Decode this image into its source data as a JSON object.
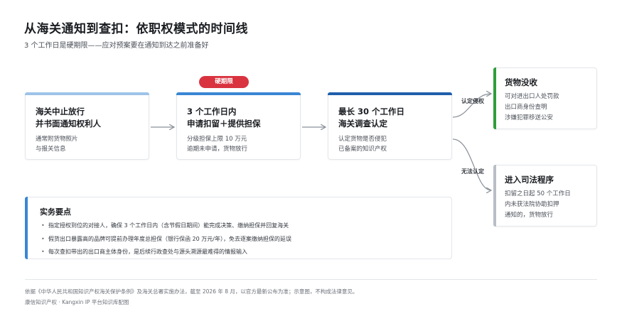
{
  "title": "从海关通知到查扣：依职权模式的时间线",
  "subtitle": "3 个工作日是硬期限——应对预案要在通知到达之前准备好",
  "badge": "硬期限",
  "steps": [
    {
      "heading": [
        "海关中止放行",
        "并书面通知权利人"
      ],
      "desc": [
        "通常附货物照片",
        "与报关信息"
      ]
    },
    {
      "heading": [
        "3 个工作日内",
        "申请扣留＋提供担保"
      ],
      "desc": [
        "分级担保上限 10 万元",
        "逾期未申请，货物放行"
      ]
    },
    {
      "heading": [
        "最长 30 个工作日",
        "海关调查认定"
      ],
      "desc": [
        "认定货物是否侵犯",
        "已备案的知识产权"
      ]
    }
  ],
  "branches": {
    "upper_label": "认定侵权",
    "lower_label": "无法认定"
  },
  "outcomes": [
    {
      "heading": "货物没收",
      "desc": [
        "可对进出口人处罚款",
        "出口商身份查明",
        "涉嫌犯罪移送公安"
      ]
    },
    {
      "heading": "进入司法程序",
      "desc": [
        "扣留之日起 50 个工作日",
        "内未获法院协助扣押",
        "通知的，货物放行"
      ]
    }
  ],
  "notes": {
    "heading": "实务要点",
    "items": [
      "指定授权到位的对接人，确保 3 个工作日内（含节假日期间）能完成决策、缴纳担保并回复海关",
      "假货出口暴露高的品牌可提前办理年度总担保（银行保函 20 万元/年），免去逐案缴纳担保的延误",
      "每次查扣带出的出口商主体身份，是后续行政查处与源头溯源最难得的情报输入"
    ]
  },
  "footer": {
    "line1": "依据《中华人民共和国知识产权海关保护条例》及海关总署实施办法，截至 2026 年 8 月，以官方最新公布为准；示意图，不构成法律意见。",
    "line2": "康信知识产权 · Kangxin IP 平台知识库配图"
  },
  "colors": {
    "step1_bar": "#9ec3e8",
    "step2_bar": "#3a86d4",
    "step3_bar": "#1f5faa",
    "badge": "#d9333f",
    "outcome_positive": "#2e9e3a",
    "outcome_neutral": "#b9bec6",
    "notes_accent": "#3a86d4"
  }
}
